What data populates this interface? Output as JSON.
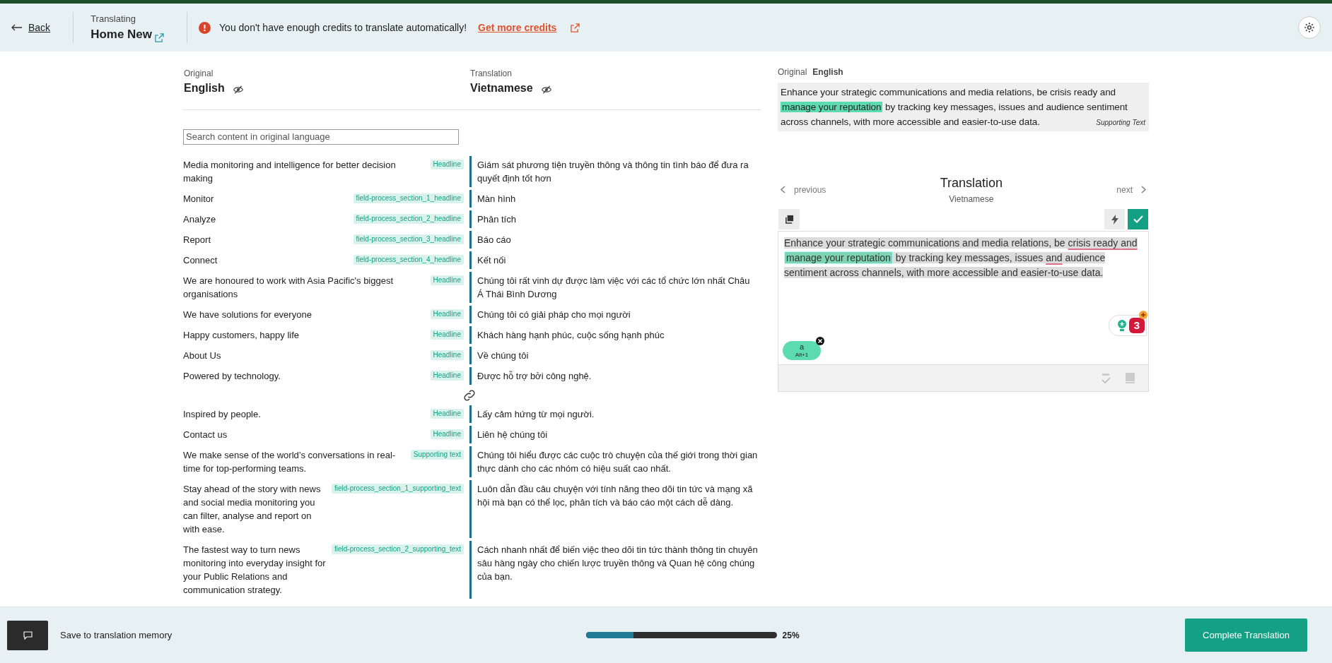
{
  "header": {
    "back": "Back",
    "context": "Translating",
    "title": "Home New",
    "alert": "You don't have enough credits to translate automatically!",
    "alert_link": "Get more credits"
  },
  "languages": {
    "original_label": "Original",
    "original": "English",
    "translation_label": "Translation",
    "translation": "Vietnamese"
  },
  "search": {
    "placeholder": "Search content in original language"
  },
  "rows": [
    {
      "kind": "segment",
      "source": "Media monitoring and intelligence for better decision making",
      "tag": "Headline",
      "translation": "Giám sát phương tiện truyền thông và thông tin tình báo để đưa ra quyết định tốt hơn"
    },
    {
      "kind": "segment",
      "source": "Monitor",
      "tag": "field-process_section_1_headline",
      "translation": "Màn hình"
    },
    {
      "kind": "segment",
      "source": "Analyze",
      "tag": "field-process_section_2_headline",
      "translation": "Phân tích"
    },
    {
      "kind": "segment",
      "source": "Report",
      "tag": "field-process_section_3_headline",
      "translation": "Báo cáo"
    },
    {
      "kind": "segment",
      "source": "Connect",
      "tag": "field-process_section_4_headline",
      "translation": "Kết nối"
    },
    {
      "kind": "segment",
      "source": "We are honoured to work with Asia Pacific's biggest organisations",
      "tag": "Headline",
      "translation": "Chúng tôi rất vinh dự được làm việc với các tổ chức lớn nhất Châu Á Thái Bình Dương"
    },
    {
      "kind": "segment",
      "source": "We have solutions for everyone",
      "tag": "Headline",
      "translation": "Chúng tôi có giải pháp cho mọi người"
    },
    {
      "kind": "segment",
      "source": "Happy customers, happy life",
      "tag": "Headline",
      "translation": "Khách hàng hạnh phúc, cuộc sống hạnh phúc"
    },
    {
      "kind": "segment",
      "source": "About Us",
      "tag": "Headline",
      "translation": "Về chúng tôi"
    },
    {
      "kind": "segment",
      "source": "Powered by technology.",
      "tag": "Headline",
      "translation": "Được hỗ trợ bởi công nghệ."
    },
    {
      "kind": "link"
    },
    {
      "kind": "segment",
      "source": "Inspired by people.",
      "tag": "Headline",
      "translation": "Lấy cảm hứng từ mọi người."
    },
    {
      "kind": "segment",
      "source": "Contact us",
      "tag": "Headline",
      "translation": "Liên hệ chúng tôi"
    },
    {
      "kind": "segment",
      "source": "We make sense of the world’s conversations in real-time for top-performing teams.",
      "tag": "Supporting text",
      "translation": "Chúng tôi hiểu được các cuộc trò chuyện của thế giới trong thời gian thực dành cho các nhóm có hiệu suất cao nhất."
    },
    {
      "kind": "segment",
      "source": "Stay ahead of the story with news and social media monitoring you can filter, analyse and report on with ease.",
      "tag": "field-process_section_1_supporting_text",
      "translation": "Luôn dẫn đầu câu chuyện với tính năng theo dõi tin tức và mạng xã hội mà bạn có thể lọc, phân tích và báo cáo một cách dễ dàng."
    },
    {
      "kind": "segment",
      "source": "The fastest way to turn news monitoring into everyday insight for your Public Relations and communication strategy.",
      "tag": "field-process_section_2_supporting_text",
      "translation": "Cách nhanh nhất để biến việc theo dõi tin tức thành thông tin chuyên sâu hàng ngày cho chiến lược truyền thông và Quan hệ công chúng của bạn."
    }
  ],
  "source_panel": {
    "label": "Original",
    "language": "English",
    "tag": "Supporting Text",
    "segments": [
      {
        "text": "Enhance your strategic communications and media relations, be crisis ready and ",
        "highlighted": false
      },
      {
        "text": "manage your reputation",
        "highlighted": true
      },
      {
        "text": " by tracking key messages, issues and audience sentiment across channels, with more accessible and easier-to-use data.",
        "highlighted": false
      }
    ]
  },
  "editor": {
    "previous": "previous",
    "title": "Translation",
    "language": "Vietnamese",
    "next": "next",
    "segments": [
      {
        "text": "Enhance your strategic communications and media relations, be ",
        "highlighted": false,
        "misspelled": false
      },
      {
        "text": "crisis ready ",
        "highlighted": false,
        "misspelled": true
      },
      {
        "text": "and ",
        "highlighted": false,
        "misspelled": true
      },
      {
        "text": "manage your reputation",
        "highlighted": true,
        "misspelled": false
      },
      {
        "text": " by tracking key messages, issues ",
        "highlighted": false,
        "misspelled": false
      },
      {
        "text": "and",
        "highlighted": false,
        "misspelled": true
      },
      {
        "text": " audience sentiment across channels, with more accessible and easier-to-use data.",
        "highlighted": false,
        "misspelled": false
      }
    ],
    "token": {
      "label": "a",
      "shortcut": "Alt+1"
    },
    "badge": "3"
  },
  "footer": {
    "save": "Save to translation memory",
    "progress": {
      "level": 0.25,
      "reading": "25%"
    },
    "complete": "Complete Translation"
  }
}
